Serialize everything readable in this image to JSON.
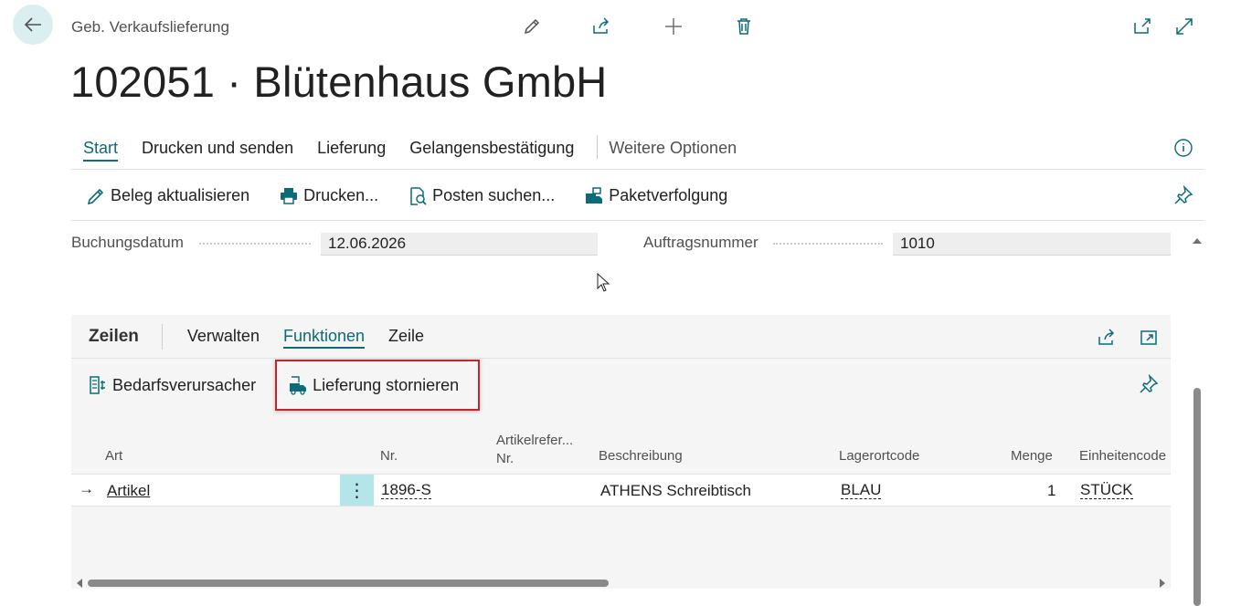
{
  "header": {
    "caption": "Geb. Verkaufslieferung",
    "title": "102051 · Blütenhaus GmbH"
  },
  "action_tabs": [
    "Start",
    "Drucken und senden",
    "Lieferung",
    "Gelangensbestätigung",
    "Weitere Optionen"
  ],
  "commands": [
    "Beleg aktualisieren",
    "Drucken...",
    "Posten suchen...",
    "Paketverfolgung"
  ],
  "fields": {
    "posting_date_label": "Buchungsdatum",
    "posting_date_value": "12.06.2026",
    "order_no_label": "Auftragsnummer",
    "order_no_value": "1010"
  },
  "lines": {
    "title": "Zeilen",
    "tabs": [
      "Verwalten",
      "Funktionen",
      "Zeile"
    ],
    "commands": [
      "Bedarfsverursacher",
      "Lieferung stornieren"
    ],
    "columns": {
      "type": "Art",
      "no": "Nr.",
      "item_ref_1": "Artikelrefer...",
      "item_ref_2": "Nr.",
      "description": "Beschreibung",
      "location": "Lagerortcode",
      "quantity": "Menge",
      "uom": "Einheitencode"
    },
    "rows": [
      {
        "marker": "→",
        "type": "Artikel",
        "menu": "⋮",
        "no": "1896-S",
        "item_ref": "",
        "description": "ATHENS Schreibtisch",
        "location": "BLAU",
        "quantity": "1",
        "uom": "STÜCK"
      }
    ]
  },
  "colors": {
    "accent": "#0b6b78",
    "highlight_border": "#c0262d",
    "selected_cell": "#b4e5e9"
  }
}
